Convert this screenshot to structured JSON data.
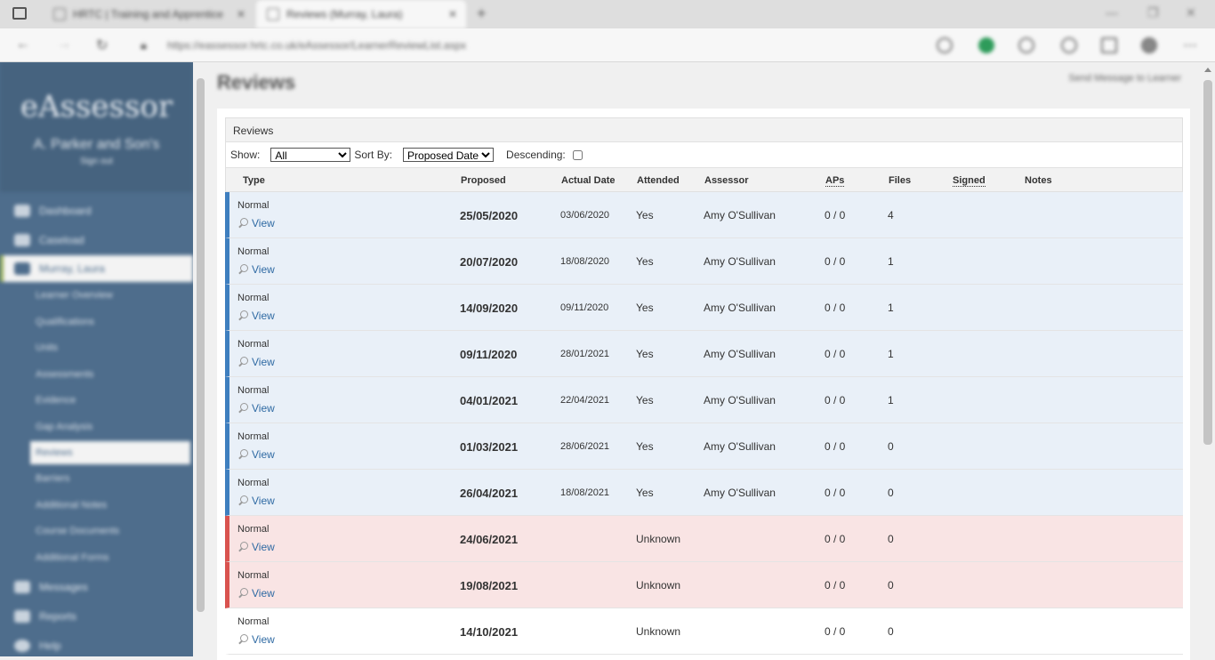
{
  "browser": {
    "tabs": [
      {
        "title": "HRTC | Training and Apprentice"
      },
      {
        "title": "Reviews (Murray, Laura)"
      }
    ],
    "url": "https://eassessor.hrtc.co.uk/eAssessor/LearnerReviewList.aspx"
  },
  "sidebar": {
    "logo": "eAssessor",
    "company": "A. Parker and Son's",
    "signout": "Sign out",
    "items": [
      {
        "label": "Dashboard",
        "icon": "dashboard-icon"
      },
      {
        "label": "Caseload",
        "icon": "caseload-icon"
      },
      {
        "label": "Murray, Laura",
        "icon": "learner-icon"
      }
    ],
    "subitems": [
      "Learner Overview",
      "Qualifications",
      "Units",
      "Assessments",
      "Evidence",
      "Gap Analysis",
      "Reviews",
      "Barriers",
      "Additional Notes",
      "Course Documents",
      "Additional Forms"
    ],
    "bottom_items": [
      {
        "label": "Messages",
        "icon": "messages-icon"
      },
      {
        "label": "Reports",
        "icon": "reports-icon"
      },
      {
        "label": "Help",
        "icon": "help-icon"
      }
    ]
  },
  "main": {
    "title": "Reviews",
    "send_message": "Send Message to Learner",
    "panel_title": "Reviews",
    "filters": {
      "show_label": "Show:",
      "show_value": "All",
      "sort_label": "Sort By:",
      "sort_value": "Proposed Date",
      "descending_label": "Descending:"
    },
    "columns": [
      "Type",
      "Proposed",
      "Actual Date",
      "Attended",
      "Assessor",
      "APs",
      "Files",
      "Signed",
      "Notes"
    ],
    "rows": [
      {
        "type": "Normal",
        "view": "View",
        "proposed": "25/05/2020",
        "actual": "03/06/2020",
        "attended": "Yes",
        "assessor": "Amy O'Sullivan",
        "aps": "0 / 0",
        "files": "4",
        "status": "blue"
      },
      {
        "type": "Normal",
        "view": "View",
        "proposed": "20/07/2020",
        "actual": "18/08/2020",
        "attended": "Yes",
        "assessor": "Amy O'Sullivan",
        "aps": "0 / 0",
        "files": "1",
        "status": "blue"
      },
      {
        "type": "Normal",
        "view": "View",
        "proposed": "14/09/2020",
        "actual": "09/11/2020",
        "attended": "Yes",
        "assessor": "Amy O'Sullivan",
        "aps": "0 / 0",
        "files": "1",
        "status": "blue"
      },
      {
        "type": "Normal",
        "view": "View",
        "proposed": "09/11/2020",
        "actual": "28/01/2021",
        "attended": "Yes",
        "assessor": "Amy O'Sullivan",
        "aps": "0 / 0",
        "files": "1",
        "status": "blue"
      },
      {
        "type": "Normal",
        "view": "View",
        "proposed": "04/01/2021",
        "actual": "22/04/2021",
        "attended": "Yes",
        "assessor": "Amy O'Sullivan",
        "aps": "0 / 0",
        "files": "1",
        "status": "blue"
      },
      {
        "type": "Normal",
        "view": "View",
        "proposed": "01/03/2021",
        "actual": "28/06/2021",
        "attended": "Yes",
        "assessor": "Amy O'Sullivan",
        "aps": "0 / 0",
        "files": "0",
        "status": "blue"
      },
      {
        "type": "Normal",
        "view": "View",
        "proposed": "26/04/2021",
        "actual": "18/08/2021",
        "attended": "Yes",
        "assessor": "Amy O'Sullivan",
        "aps": "0 / 0",
        "files": "0",
        "status": "blue"
      },
      {
        "type": "Normal",
        "view": "View",
        "proposed": "24/06/2021",
        "actual": "",
        "attended": "Unknown",
        "assessor": "",
        "aps": "0 / 0",
        "files": "0",
        "status": "red"
      },
      {
        "type": "Normal",
        "view": "View",
        "proposed": "19/08/2021",
        "actual": "",
        "attended": "Unknown",
        "assessor": "",
        "aps": "0 / 0",
        "files": "0",
        "status": "red"
      },
      {
        "type": "Normal",
        "view": "View",
        "proposed": "14/10/2021",
        "actual": "",
        "attended": "Unknown",
        "assessor": "",
        "aps": "0 / 0",
        "files": "0",
        "status": "white"
      }
    ]
  }
}
